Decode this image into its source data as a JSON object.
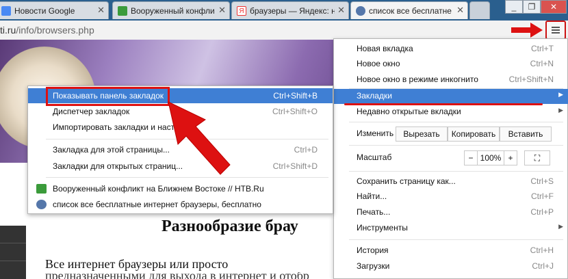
{
  "tabs": [
    {
      "title": "Новости Google",
      "favicon": "google-news-icon",
      "color": "#4a8af4"
    },
    {
      "title": "Вооруженный конфли",
      "favicon": "ntv-icon",
      "color": "#3b9b3b"
    },
    {
      "title": "браузеры — Яндекс: н",
      "favicon": "yandex-icon",
      "color": "#e33"
    },
    {
      "title": "список все бесплатне",
      "favicon": "site-icon",
      "color": "#5577aa"
    }
  ],
  "window_controls": {
    "minimize": "_",
    "restore": "❐",
    "close": "✕"
  },
  "address": {
    "domain": "ti.ru",
    "path": "/info/browsers.php"
  },
  "menu_icon": "hamburger-menu-icon",
  "page": {
    "heading": "Разнообразие брау",
    "body_line1": "Все   интернет   браузеры   или   просто",
    "body_line2": "предназначенными для выхода в интернет и отобр"
  },
  "main_menu": {
    "new_tab": {
      "label": "Новая вкладка",
      "shortcut": "Ctrl+T"
    },
    "new_window": {
      "label": "Новое окно",
      "shortcut": "Ctrl+N"
    },
    "incognito": {
      "label": "Новое окно в режиме инкогнито",
      "shortcut": "Ctrl+Shift+N"
    },
    "bookmarks": {
      "label": "Закладки"
    },
    "recent_tabs": {
      "label": "Недавно открытые вкладки"
    },
    "edit": {
      "label": "Изменить",
      "cut": "Вырезать",
      "copy": "Копировать",
      "paste": "Вставить"
    },
    "zoom": {
      "label": "Масштаб",
      "minus": "−",
      "value": "100%",
      "plus": "+",
      "fullscreen": "⛶"
    },
    "save_page": {
      "label": "Сохранить страницу как...",
      "shortcut": "Ctrl+S"
    },
    "find": {
      "label": "Найти...",
      "shortcut": "Ctrl+F"
    },
    "print": {
      "label": "Печать...",
      "shortcut": "Ctrl+P"
    },
    "tools": {
      "label": "Инструменты"
    },
    "history": {
      "label": "История",
      "shortcut": "Ctrl+H"
    },
    "downloads": {
      "label": "Загрузки",
      "shortcut": "Ctrl+J"
    }
  },
  "bookmarks_menu": {
    "show_bar": {
      "label": "Показывать панель закладок",
      "shortcut": "Ctrl+Shift+B"
    },
    "manager": {
      "label": "Диспетчер закладок",
      "shortcut": "Ctrl+Shift+O"
    },
    "import": {
      "label": "Импортировать закладки и настр"
    },
    "bookmark_page": {
      "label": "Закладка для этой страницы...",
      "shortcut": "Ctrl+D"
    },
    "bookmark_all": {
      "label": "Закладки для открытых страниц...",
      "shortcut": "Ctrl+Shift+D"
    },
    "item1": {
      "label": "Вооруженный конфликт на Ближнем Востоке // НТВ.Ru",
      "icon": "ntv-icon"
    },
    "item2": {
      "label": "список все бесплатные интернет браузеры, бесплатно",
      "icon": "site-icon"
    }
  },
  "colors": {
    "highlight": "#3f7fd4",
    "annotation": "#dd1111"
  }
}
